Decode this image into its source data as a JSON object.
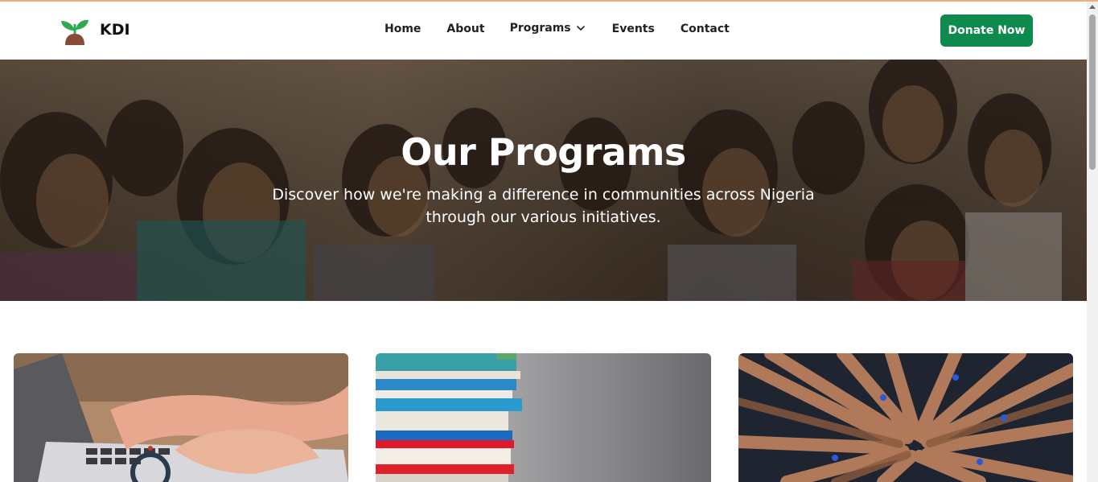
{
  "brand": {
    "name": "KDI",
    "logo_icon": "sprout-icon"
  },
  "nav": {
    "home": "Home",
    "about": "About",
    "programs": "Programs",
    "events": "Events",
    "contact": "Contact"
  },
  "header": {
    "donate_label": "Donate Now"
  },
  "hero": {
    "title": "Our Programs",
    "subtitle": "Discover how we're making a difference in communities across Nigeria through our various initiatives."
  },
  "colors": {
    "primary": "#0f8a4f",
    "accent_line": "#e8b27a"
  }
}
